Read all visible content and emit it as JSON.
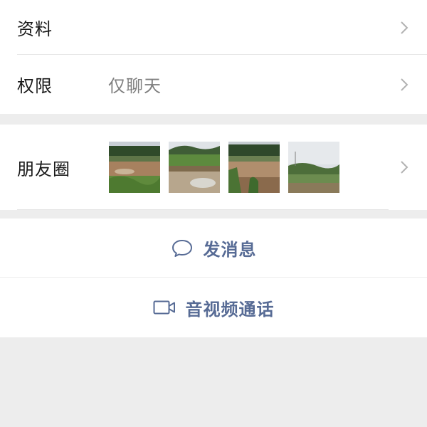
{
  "profile": {
    "label": "资料"
  },
  "permission": {
    "label": "权限",
    "value": "仅聊天"
  },
  "moments": {
    "label": "朋友圈",
    "thumbnails": [
      "field-photo-1",
      "field-photo-2",
      "field-photo-3",
      "field-photo-4"
    ]
  },
  "actions": {
    "message_label": "发消息",
    "call_label": "音视频通话"
  },
  "colors": {
    "accent": "#576b95",
    "background": "#ededed",
    "card": "#ffffff"
  },
  "icons": {
    "chevron": "chevron-right-icon",
    "message": "chat-bubble-icon",
    "call": "video-camera-icon"
  }
}
